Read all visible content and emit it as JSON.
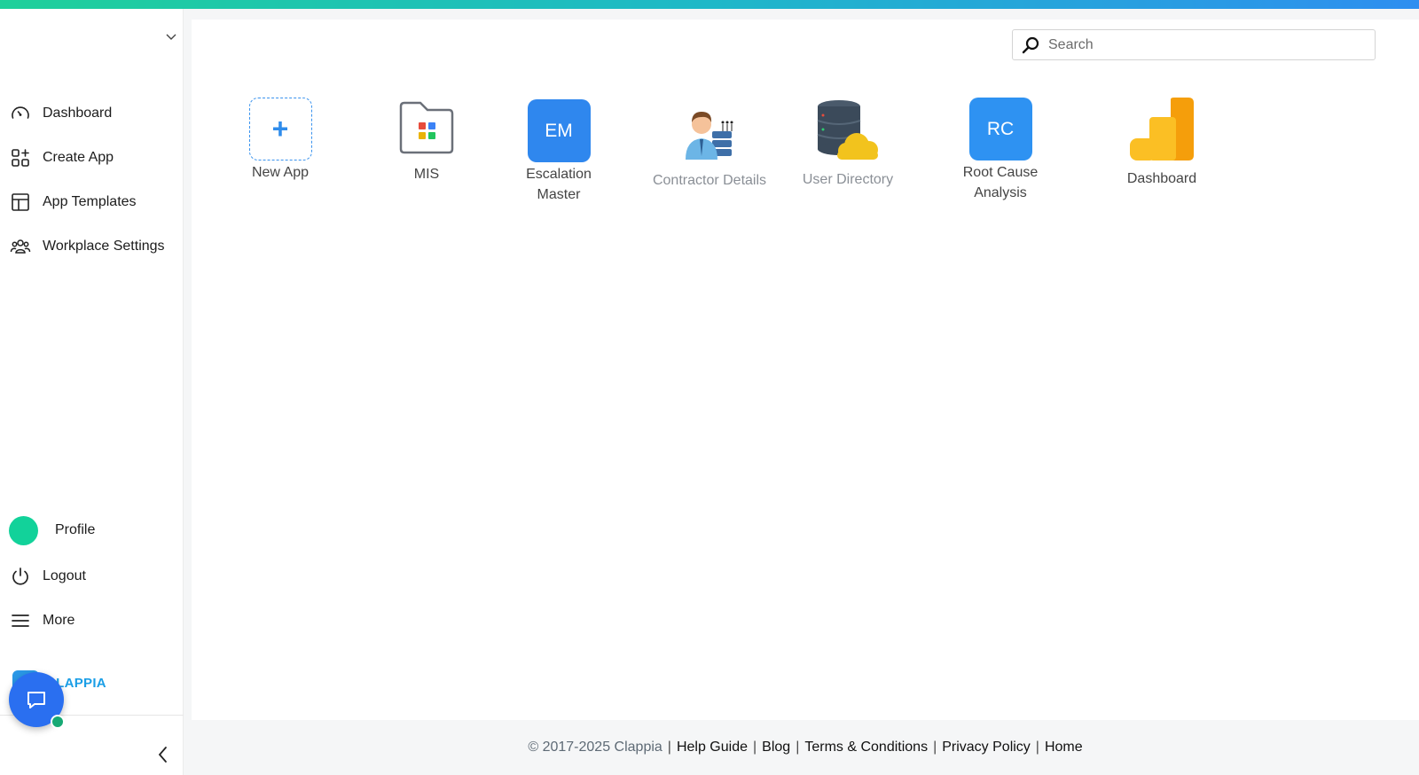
{
  "sidebar": {
    "nav": [
      {
        "label": "Dashboard",
        "icon": "gauge-icon"
      },
      {
        "label": "Create App",
        "icon": "grid-plus-icon"
      },
      {
        "label": "App Templates",
        "icon": "layout-icon"
      },
      {
        "label": "Workplace Settings",
        "icon": "users-icon"
      }
    ],
    "profile_label": "Profile",
    "logout_label": "Logout",
    "more_label": "More",
    "brand_name": "CLAPPIA"
  },
  "search": {
    "placeholder": "Search",
    "value": ""
  },
  "apps": [
    {
      "label": "New App",
      "type": "new"
    },
    {
      "label": "MIS",
      "type": "folder"
    },
    {
      "label": "Escalation Master",
      "initials": "EM",
      "color": "#2f87ee"
    },
    {
      "label": "Contractor Details",
      "type": "illustration"
    },
    {
      "label": "User Directory",
      "type": "illustration"
    },
    {
      "label": "Root Cause Analysis",
      "initials": "RC",
      "color": "#2e92f2"
    },
    {
      "label": "Dashboard",
      "type": "analytics"
    }
  ],
  "footer": {
    "copyright": "© 2017-2025 Clappia",
    "links": [
      "Help Guide",
      "Blog",
      "Terms & Conditions",
      "Privacy Policy",
      "Home"
    ]
  },
  "colors": {
    "accent": "#2e8ef0",
    "brand_green": "#12d29a",
    "chat_fab": "#2a6ff0"
  }
}
